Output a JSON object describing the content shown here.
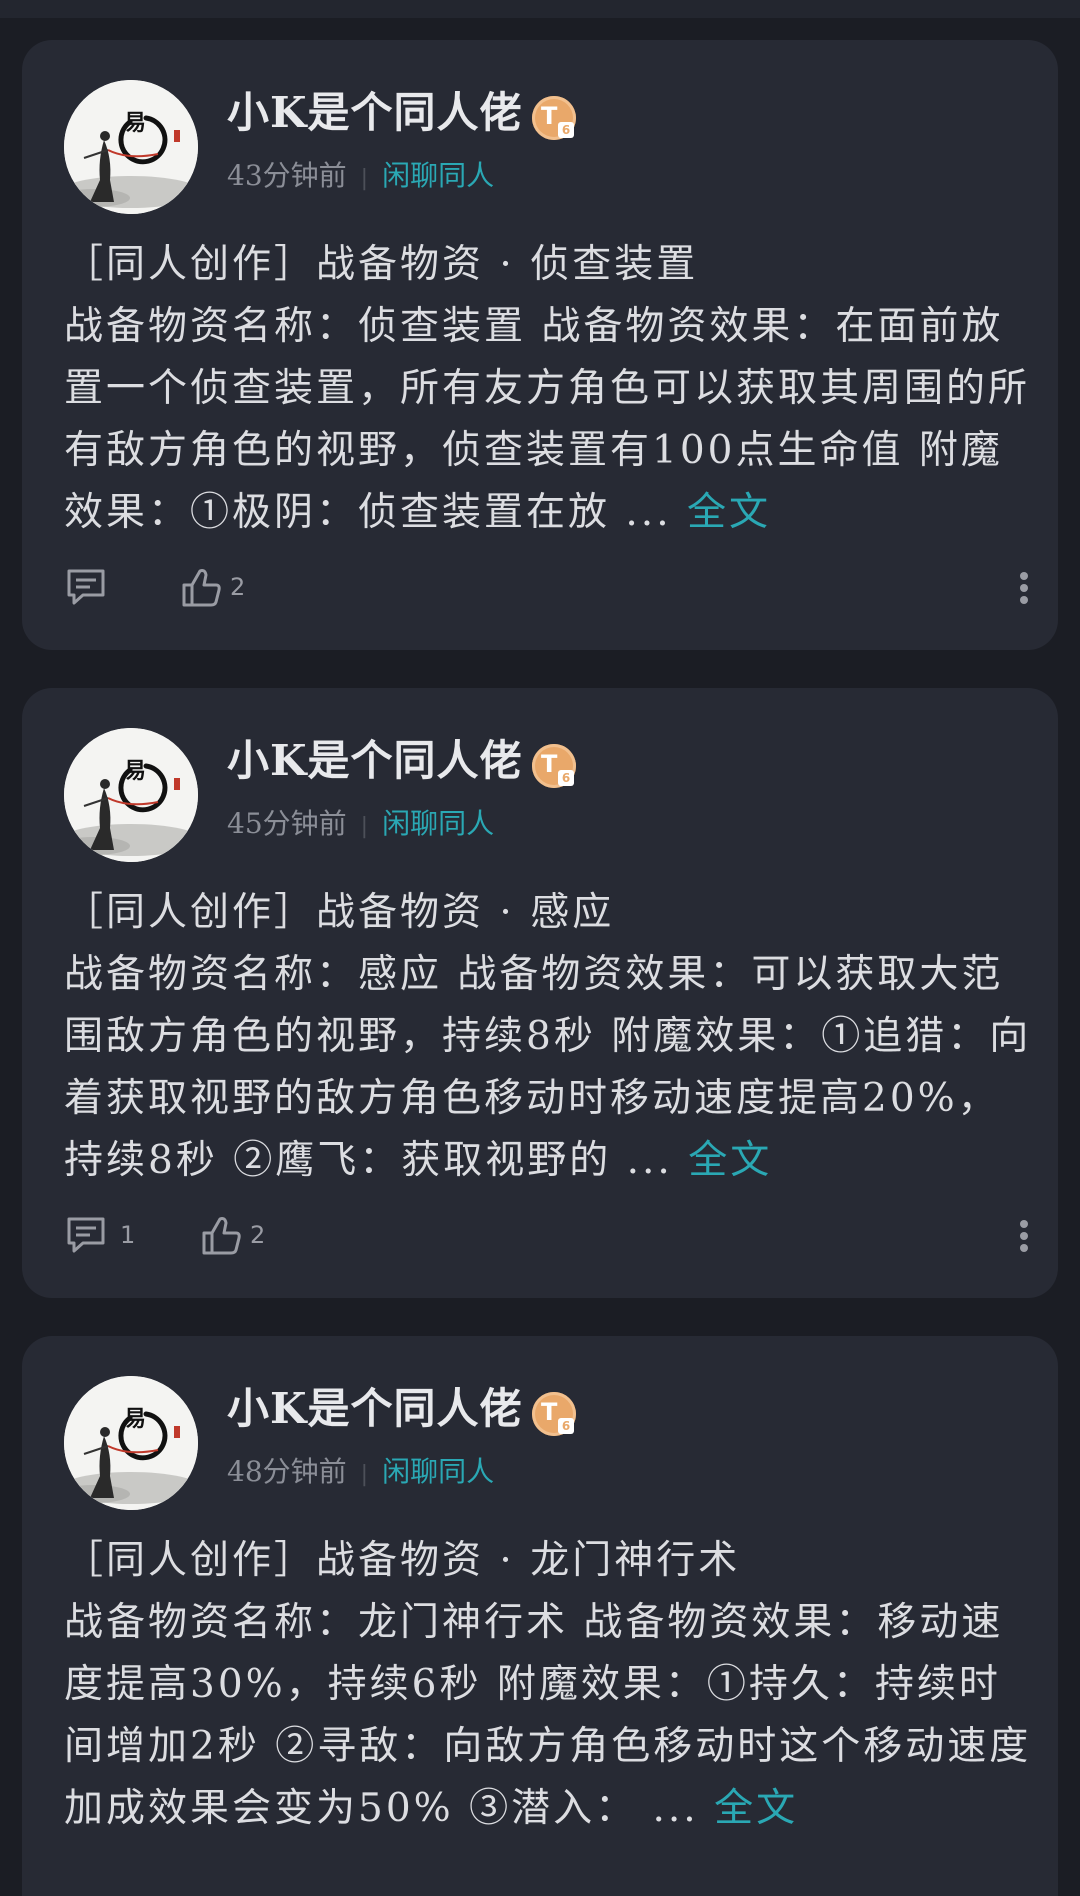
{
  "posts": [
    {
      "author": "小K是个同人佬",
      "badge": "T",
      "badge_level": "6",
      "time": "43分钟前",
      "topic": "闲聊同人",
      "title": "［同人创作］战备物资 · 侦查装置",
      "content": "战备物资名称：侦查装置 战备物资效果：在面前放置一个侦查装置，所有友方角色可以获取其周围的所有敌方角色的视野，侦查装置有100点生命值 附魔效果：①极阴：侦查装置在放 ...",
      "full_text_label": "全文",
      "comment_count": "",
      "like_count": "2"
    },
    {
      "author": "小K是个同人佬",
      "badge": "T",
      "badge_level": "6",
      "time": "45分钟前",
      "topic": "闲聊同人",
      "title": "［同人创作］战备物资 · 感应",
      "content": "战备物资名称：感应 战备物资效果：可以获取大范围敌方角色的视野，持续8秒 附魔效果：①追猎：向着获取视野的敌方角色移动时移动速度提高20%，持续8秒 ②鹰飞：获取视野的 ...",
      "full_text_label": "全文",
      "comment_count": "1",
      "like_count": "2"
    },
    {
      "author": "小K是个同人佬",
      "badge": "T",
      "badge_level": "6",
      "time": "48分钟前",
      "topic": "闲聊同人",
      "title": "［同人创作］战备物资 · 龙门神行术",
      "content": "战备物资名称：龙门神行术 战备物资效果：移动速度提高30%，持续6秒 附魔效果：①持久：持续时间增加2秒 ②寻敌：向敌方角色移动时这个移动速度加成效果会变为50% ③潜入： ...",
      "full_text_label": "全文"
    }
  ],
  "icons": {
    "comment": "comment-icon",
    "like": "thumbs-up-icon",
    "more": "more-vertical-icon",
    "avatar": "ink-painting-avatar"
  },
  "colors": {
    "background": "#1b1d24",
    "card": "#272a34",
    "accent": "#2aa8b4",
    "badge": "#e9a86a"
  }
}
